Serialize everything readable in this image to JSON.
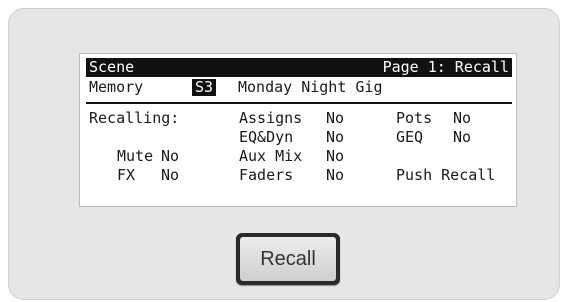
{
  "header": {
    "left": "Scene",
    "right": "Page 1: Recall"
  },
  "memory": {
    "label": "Memory",
    "slot": "S3",
    "name": "Monday Night Gig"
  },
  "recalling": {
    "label": "Recalling:",
    "mute": {
      "label": "Mute",
      "value": "No"
    },
    "fx": {
      "label": "FX",
      "value": "No"
    },
    "assigns": {
      "label": "Assigns",
      "value": "No"
    },
    "eq_dyn": {
      "label": "EQ&Dyn",
      "value": "No"
    },
    "aux_mix": {
      "label": "Aux Mix",
      "value": "No"
    },
    "faders": {
      "label": "Faders",
      "value": "No"
    },
    "pots": {
      "label": "Pots",
      "value": "No"
    },
    "geq": {
      "label": "GEQ",
      "value": "No"
    }
  },
  "prompt": "Push Recall",
  "button": {
    "label": "Recall"
  }
}
